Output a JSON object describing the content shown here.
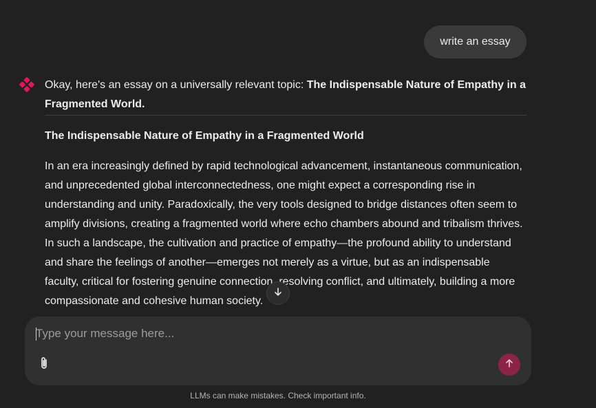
{
  "user_message": {
    "text": "write an essay"
  },
  "assistant": {
    "avatar_icon": "sparkle-logo-icon",
    "intro_prefix": "Okay, here's an essay on a universally relevant topic: ",
    "intro_bold": "The Indispensable Nature of Empathy in a Fragmented World.",
    "essay_title": "The Indispensable Nature of Empathy in a Fragmented World",
    "essay_paragraph": "In an era increasingly defined by rapid technological advancement, instantaneous communication, and unprecedented global interconnectedness, one might expect a corresponding rise in understanding and unity. Paradoxically, the very tools designed to bridge distances often seem to amplify divisions, creating a fragmented world where echo chambers abound and tribalism thrives. In such a landscape, the cultivation and practice of empathy—the profound ability to understand and share the feelings of another—emerges not merely as a virtue, but as an indispensable faculty, critical for fostering genuine connection, resolving conflict, and ultimately, building a more compassionate and cohesive human society."
  },
  "scroll_button": {
    "icon": "arrow-down-icon"
  },
  "composer": {
    "placeholder": "Type your message here...",
    "value": "",
    "attach_icon": "paperclip-icon",
    "send_icon": "arrow-up-icon"
  },
  "footer": {
    "disclaimer": "LLMs can make mistakes. Check important info."
  },
  "colors": {
    "background": "#212121",
    "user_bubble": "#3a3a3a",
    "composer": "#303030",
    "send_button": "#8b2447",
    "brand_accent": "#e2175b"
  }
}
